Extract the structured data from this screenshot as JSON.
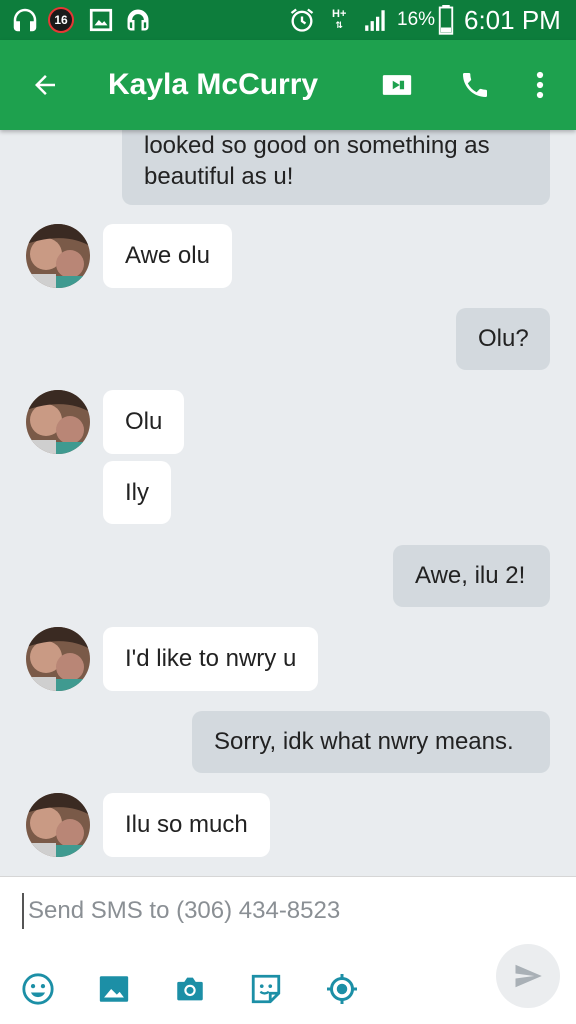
{
  "status_bar": {
    "notification_count": "16",
    "network_type": "H+",
    "battery_percent": "16%",
    "time": "6:01 PM",
    "icons": [
      "headphones-icon",
      "notification-count-icon",
      "gallery-icon",
      "headphones-icon",
      "alarm-icon",
      "network-icon",
      "signal-icon",
      "battery-icon"
    ]
  },
  "app_bar": {
    "contact_name": "Kayla McCurry",
    "icons": [
      "back-arrow-icon",
      "video-call-icon",
      "phone-icon",
      "more-options-icon"
    ]
  },
  "conversation": {
    "messages": [
      {
        "direction": "outgoing",
        "lines": [
          "looked so good on something as",
          "beautiful as u!"
        ]
      },
      {
        "direction": "incoming",
        "lines": [
          "Awe olu"
        ]
      },
      {
        "direction": "outgoing",
        "lines": [
          "Olu?"
        ]
      },
      {
        "direction": "incoming",
        "lines": [
          "Olu"
        ]
      },
      {
        "direction": "incoming",
        "lines": [
          "Ily"
        ]
      },
      {
        "direction": "outgoing",
        "lines": [
          "Awe, ilu 2!"
        ]
      },
      {
        "direction": "incoming",
        "lines": [
          "I'd like to nwry u"
        ]
      },
      {
        "direction": "outgoing",
        "lines": [
          "Sorry, idk what nwry means."
        ]
      },
      {
        "direction": "incoming",
        "lines": [
          "Ilu so much"
        ]
      }
    ]
  },
  "composer": {
    "placeholder": "Send SMS to (306) 434-8523",
    "value": "",
    "tools": [
      "emoji-icon",
      "image-icon",
      "camera-icon",
      "sticker-icon",
      "location-icon"
    ],
    "send_icon": "send-icon"
  },
  "colors": {
    "status_bar": "#0d7d3c",
    "app_bar": "#1ea14e",
    "background": "#e9ecef",
    "incoming_bubble": "#ffffff",
    "outgoing_bubble": "#d3d9de"
  }
}
